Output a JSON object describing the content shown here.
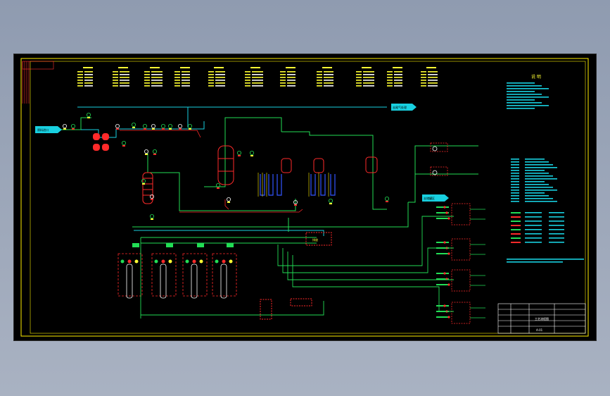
{
  "sheet": {
    "title_block_name": "工艺流程图",
    "title_block_code": "A-01"
  },
  "labels": {
    "feed_inlet": "原料进口",
    "top_outlet": "去尾气处理",
    "side_outlet": "去储罐区",
    "pump_group": "P-101",
    "drain_unit": "排放",
    "legend_title": "说 明"
  },
  "colors": {
    "background": "#000000",
    "pipe_green": "#22dd55",
    "pipe_cyan": "#18d0e0",
    "equipment_red": "#ff2a2a",
    "text_yellow": "#ffff33",
    "equipment_blue": "#3355ff",
    "frame_yellow": "#ffee00"
  }
}
